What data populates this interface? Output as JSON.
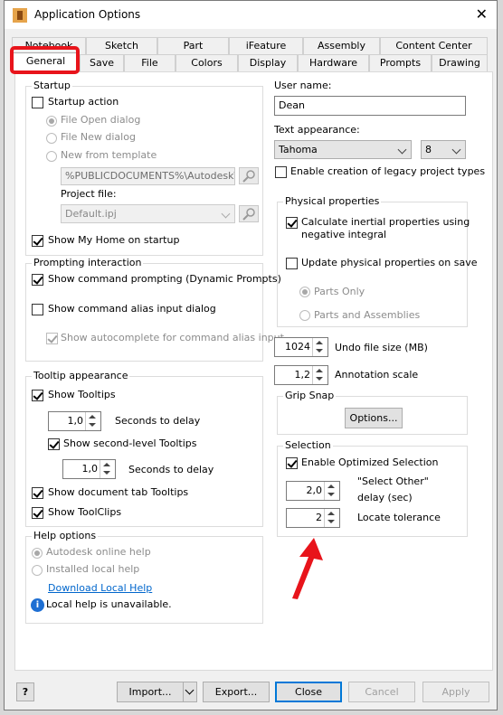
{
  "window": {
    "title": "Application Options",
    "close_glyph": "✕"
  },
  "tabs": {
    "row1": [
      "Notebook",
      "Sketch",
      "Part",
      "iFeature",
      "Assembly",
      "Content Center"
    ],
    "row2": [
      "General",
      "Save",
      "File",
      "Colors",
      "Display",
      "Hardware",
      "Prompts",
      "Drawing"
    ],
    "active": "General"
  },
  "startup": {
    "title": "Startup",
    "startup_action": "Startup action",
    "opt_file_open": "File Open dialog",
    "opt_file_new": "File New dialog",
    "opt_template": "New from template",
    "template_path": "%PUBLICDOCUMENTS%\\Autodesk\\Inv",
    "project_file_label": "Project file:",
    "project_file_value": "Default.ipj",
    "show_my_home": "Show My Home on startup"
  },
  "prompting": {
    "title": "Prompting interaction",
    "show_command_prompting": "Show command prompting (Dynamic Prompts)",
    "show_alias_dialog": "Show command alias input dialog",
    "show_autocomplete": "Show autocomplete for command alias input"
  },
  "tooltip": {
    "title": "Tooltip appearance",
    "show_tooltips": "Show Tooltips",
    "delay1_value": "1,0",
    "delay1_label": "Seconds to delay",
    "show_second_level": "Show second-level Tooltips",
    "delay2_value": "1,0",
    "delay2_label": "Seconds to delay",
    "show_doc_tab": "Show document tab Tooltips",
    "show_toolclips": "Show ToolClips"
  },
  "help": {
    "title": "Help options",
    "online_help": "Autodesk online help",
    "installed_help": "Installed local help",
    "download_link": "Download Local Help",
    "info_glyph": "i",
    "local_unavailable": "Local help is unavailable."
  },
  "right": {
    "user_name_label": "User name:",
    "user_name_value": "Dean",
    "text_appearance_label": "Text appearance:",
    "font_value": "Tahoma",
    "font_size_value": "8",
    "legacy_types": "Enable creation of legacy project types"
  },
  "physical": {
    "title": "Physical properties",
    "calc_inertial": "Calculate inertial properties using",
    "calc_inertial_2": "negative integral",
    "update_on_save": "Update physical properties on save",
    "parts_only": "Parts Only",
    "parts_assemblies": "Parts and Assemblies"
  },
  "undo": {
    "value": "1024",
    "label": "Undo file size (MB)"
  },
  "annotation": {
    "value": "1,2",
    "label": "Annotation scale"
  },
  "grip_snap": {
    "title": "Grip Snap",
    "options_button": "Options..."
  },
  "selection": {
    "title": "Selection",
    "enable_optimized": "Enable Optimized Selection",
    "select_other_value": "2,0",
    "select_other_label1": "\"Select Other\"",
    "select_other_label2": "delay (sec)",
    "locate_value": "2",
    "locate_label": "Locate tolerance"
  },
  "footer": {
    "help_glyph": "?",
    "import": "Import...",
    "export": "Export...",
    "close": "Close",
    "cancel": "Cancel",
    "apply": "Apply"
  },
  "colors": {
    "highlight": "#e8141b",
    "link": "#0066cc",
    "focus": "#0078d7",
    "info": "#1e6fd3"
  }
}
